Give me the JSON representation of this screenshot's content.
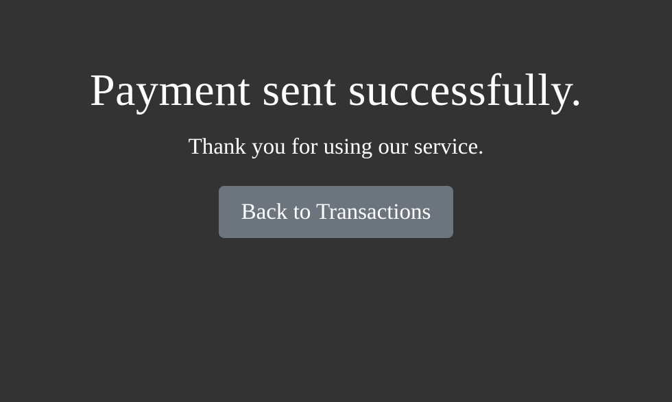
{
  "main": {
    "title": "Payment sent successfully.",
    "message": "Thank you for using our service.",
    "back_button_label": "Back to Transactions"
  },
  "colors": {
    "background": "#333333",
    "text": "#ffffff",
    "button": "#6c757d"
  }
}
